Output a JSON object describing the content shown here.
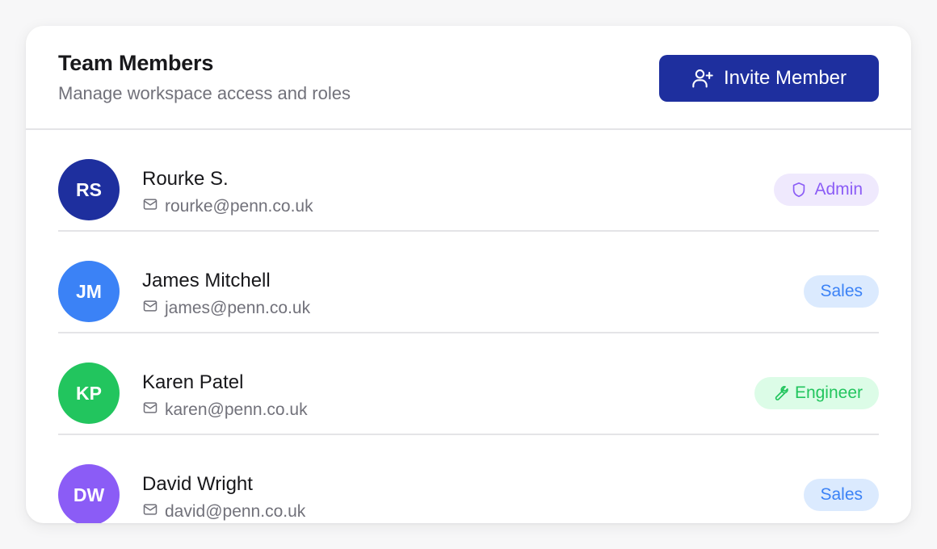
{
  "header": {
    "title": "Team Members",
    "subtitle": "Manage workspace access and roles",
    "invite_label": "Invite Member",
    "invite_icon": "user-plus-icon"
  },
  "members": [
    {
      "initials": "RS",
      "name": "Rourke S.",
      "email": "rourke@penn.co.uk",
      "avatar_color": "#1e2f9e",
      "role": "Admin",
      "role_icon": "shield-icon",
      "badge_bg": "#efe9fd",
      "badge_fg": "#8b5cf6"
    },
    {
      "initials": "JM",
      "name": "James Mitchell",
      "email": "james@penn.co.uk",
      "avatar_color": "#3b82f6",
      "role": "Sales",
      "role_icon": "",
      "badge_bg": "#dbeafe",
      "badge_fg": "#3b82f6"
    },
    {
      "initials": "KP",
      "name": "Karen Patel",
      "email": "karen@penn.co.uk",
      "avatar_color": "#22c55e",
      "role": "Engineer",
      "role_icon": "wrench-icon",
      "badge_bg": "#dcfce7",
      "badge_fg": "#22c55e"
    },
    {
      "initials": "DW",
      "name": "David Wright",
      "email": "david@penn.co.uk",
      "avatar_color": "#8b5cf6",
      "role": "Sales",
      "role_icon": "",
      "badge_bg": "#dbeafe",
      "badge_fg": "#3b82f6"
    }
  ]
}
